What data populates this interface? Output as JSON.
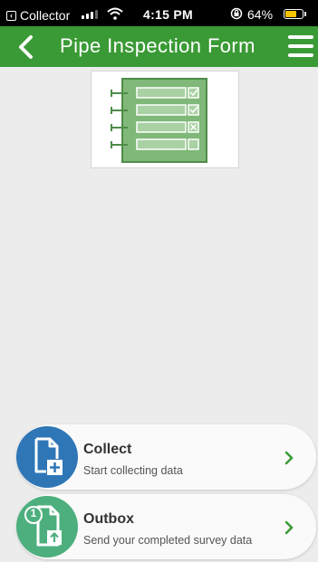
{
  "status_bar": {
    "app_name": "Collector",
    "time": "4:15 PM",
    "battery_percent": "64%",
    "battery_level": 0.64,
    "battery_color": "#f3c300"
  },
  "header": {
    "title": "Pipe Inspection Form",
    "background_color": "#3a9a35",
    "back_icon": "chevron-left-icon",
    "menu_icon": "hamburger-menu-icon"
  },
  "thumbnail": {
    "icon": "form-checklist-icon"
  },
  "actions": [
    {
      "title": "Collect",
      "subtitle": "Start collecting data",
      "icon": "new-document-icon",
      "color": "#2f76b7"
    },
    {
      "title": "Outbox",
      "subtitle": "Send your completed survey data",
      "icon": "outbox-upload-icon",
      "badge": "1",
      "color": "#4caf7d"
    }
  ]
}
